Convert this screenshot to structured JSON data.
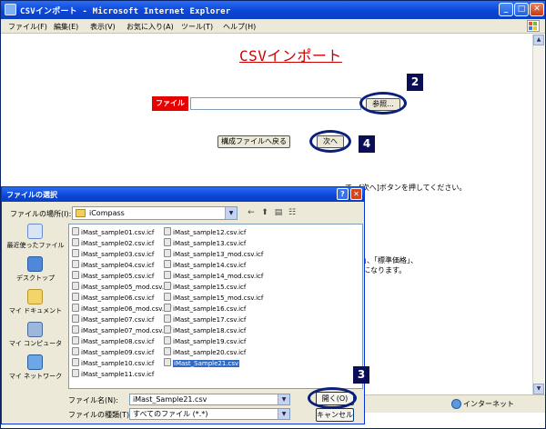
{
  "window": {
    "title": "CSVインポート - Microsoft Internet Explorer",
    "controls": {
      "minimize": "_",
      "maximize": "□",
      "close": "✕"
    }
  },
  "menubar": {
    "items": [
      "ファイル(F)",
      "編集(E)",
      "表示(V)",
      "お気に入り(A)",
      "ツール(T)",
      "ヘルプ(H)"
    ]
  },
  "page": {
    "title": "CSVインポート",
    "file_label": "ファイル",
    "file_value": "",
    "browse_button": "参照...",
    "back_button": "構成ファイルへ戻る",
    "next_button": "次へ",
    "instruction": "て、[次へ]ボタンを押してください。",
    "note_line1": "」、「標準価格」、",
    "note_line2": "になります。"
  },
  "annotations": {
    "badge_2": "2",
    "badge_3": "3",
    "badge_4": "4"
  },
  "statusbar": {
    "zone": "インターネット"
  },
  "dialog": {
    "title": "ファイルの選択",
    "help": "?",
    "close": "✕",
    "look_in_label": "ファイルの場所(I):",
    "look_in_value": "iCompass",
    "places": [
      "最近使ったファイル",
      "デスクトップ",
      "マイ ドキュメント",
      "マイ コンピュータ",
      "マイ ネットワーク"
    ],
    "files_col1": [
      "iMast_sample01.csv.icf",
      "iMast_sample02.csv.icf",
      "iMast_sample03.csv.icf",
      "iMast_sample04.csv.icf",
      "iMast_sample05.csv.icf",
      "iMast_sample05_mod.csv.icf",
      "iMast_sample06.csv.icf",
      "iMast_sample06_mod.csv.icf",
      "iMast_sample07.csv.icf",
      "iMast_sample07_mod.csv.icf",
      "iMast_sample08.csv.icf",
      "iMast_sample09.csv.icf",
      "iMast_sample10.csv.icf",
      "iMast_sample11.csv.icf"
    ],
    "files_col2": [
      "iMast_sample12.csv.icf",
      "iMast_sample13.csv.icf",
      "iMast_sample13_mod.csv.icf",
      "iMast_sample14.csv.icf",
      "iMast_sample14_mod.csv.icf",
      "iMast_sample15.csv.icf",
      "iMast_sample15_mod.csv.icf",
      "iMast_sample16.csv.icf",
      "iMast_sample17.csv.icf",
      "iMast_sample18.csv.icf",
      "iMast_sample19.csv.icf",
      "iMast_sample20.csv.icf",
      "iMast_Sample21.csv"
    ],
    "selected_file": "iMast_Sample21.csv",
    "filename_label": "ファイル名(N):",
    "filename_value": "iMast_Sample21.csv",
    "filetype_label": "ファイルの種類(T):",
    "filetype_value": "すべてのファイル (*.*)",
    "open_button": "開く(O)",
    "cancel_button": "キャンセル"
  },
  "colors": {
    "title_red": "#cc0000",
    "file_label_bg": "#e60000",
    "annotation_navy": "#0a0f55",
    "selection_blue": "#316ac5",
    "xp_titlebar": "#0a45d6"
  }
}
